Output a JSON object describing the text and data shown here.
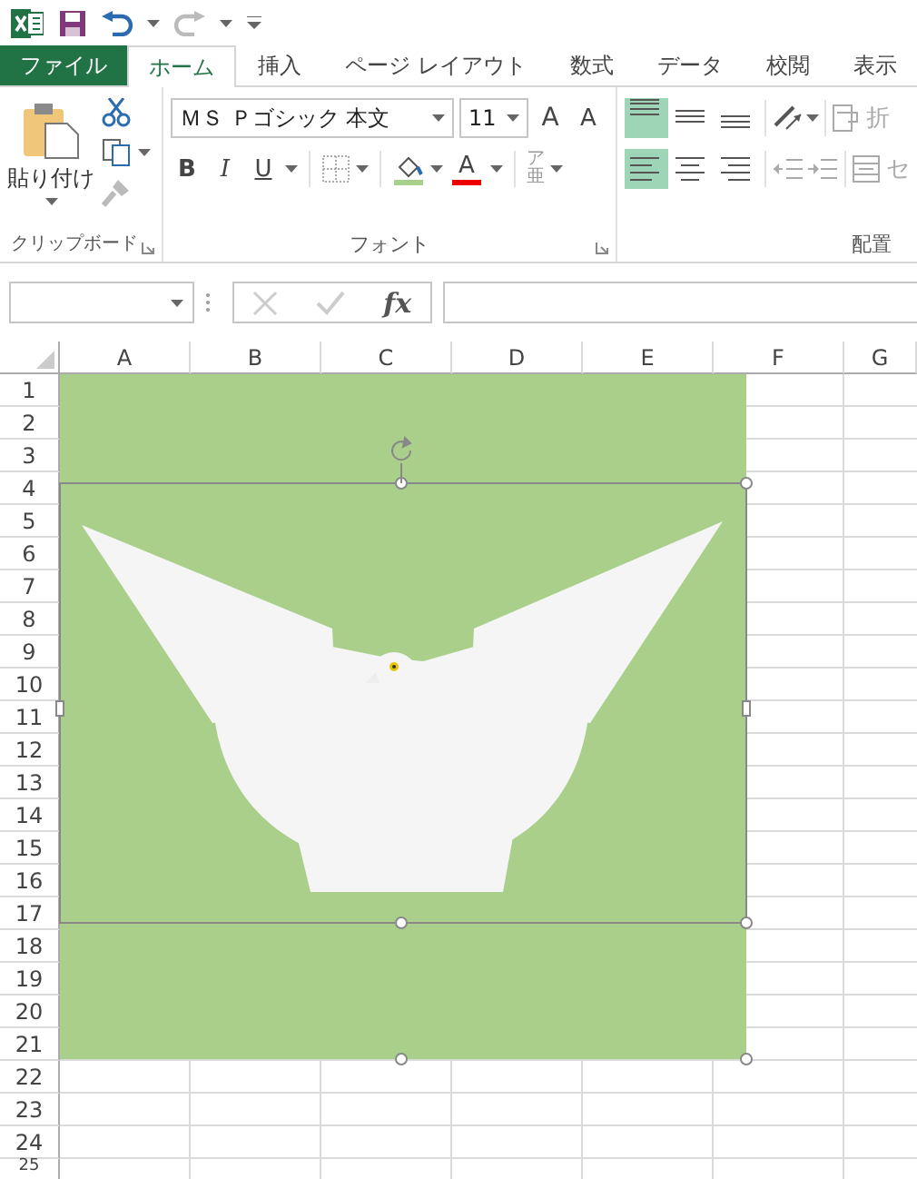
{
  "tabs": [
    {
      "label": "ファイル",
      "kind": "file",
      "selected": false
    },
    {
      "label": "ホーム",
      "kind": "tab",
      "selected": true
    },
    {
      "label": "挿入",
      "kind": "tab",
      "selected": false
    },
    {
      "label": "ページ レイアウト",
      "kind": "tab",
      "selected": false
    },
    {
      "label": "数式",
      "kind": "tab",
      "selected": false
    },
    {
      "label": "データ",
      "kind": "tab",
      "selected": false
    },
    {
      "label": "校閲",
      "kind": "tab",
      "selected": false
    },
    {
      "label": "表示",
      "kind": "tab",
      "selected": false
    }
  ],
  "ribbon": {
    "clipboard": {
      "paste_label": "貼り付け",
      "group_label": "クリップボード"
    },
    "font": {
      "font_name": "ＭＳ Ｐゴシック 本文",
      "font_size": "11",
      "grow_label": "A",
      "shrink_label": "A",
      "bold_label": "B",
      "italic_label": "I",
      "underline_label": "U",
      "font_color_label": "A",
      "phonetic_label": "亜",
      "phonetic_ruby": "ア",
      "group_label": "フォント"
    },
    "alignment": {
      "vertical": [
        {
          "kind": "top",
          "selected": true
        },
        {
          "kind": "middle",
          "selected": false
        },
        {
          "kind": "bottom",
          "selected": false
        }
      ],
      "horizontal": [
        {
          "kind": "left",
          "selected": true
        },
        {
          "kind": "center",
          "selected": false
        },
        {
          "kind": "right",
          "selected": false
        }
      ],
      "wrap_label": "折",
      "merge_label": "セ",
      "group_label": "配置"
    }
  },
  "formula_bar": {
    "function_label": "fx"
  },
  "sheet": {
    "columns": [
      "A",
      "B",
      "C",
      "D",
      "E",
      "F",
      "G"
    ],
    "rows": [
      "1",
      "2",
      "3",
      "4",
      "5",
      "6",
      "7",
      "8",
      "9",
      "10",
      "11",
      "12",
      "13",
      "14",
      "15",
      "16",
      "17",
      "18",
      "19",
      "20",
      "21",
      "22",
      "23",
      "24",
      "25"
    ]
  }
}
